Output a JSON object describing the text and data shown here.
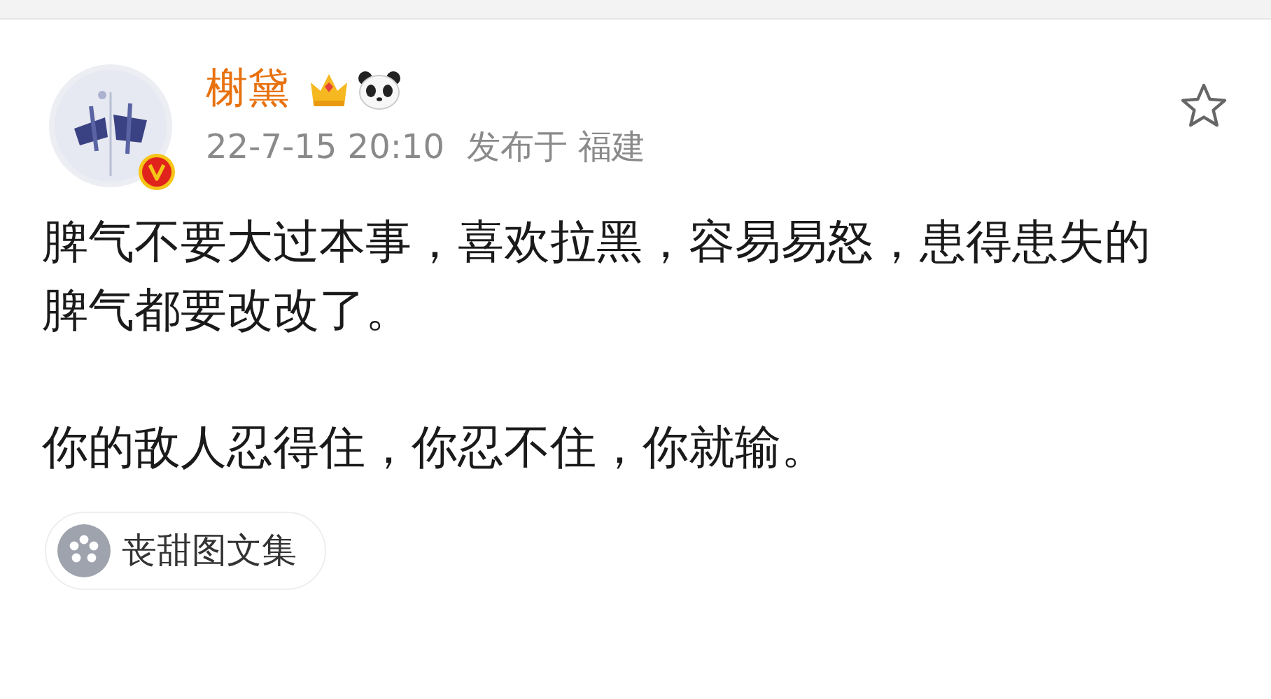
{
  "post": {
    "author": {
      "name": "榭黛",
      "verified": true
    },
    "time": "22-7-15 20:10",
    "location": "发布于 福建",
    "starred": false,
    "paragraphs": [
      "脾气不要大过本事，喜欢拉黑，容易易怒，患得患失的脾气都要改改了。",
      "你的敌人忍得住，你忍不住，你就输。"
    ],
    "topic_chip": {
      "label": "丧甜图文集"
    }
  }
}
